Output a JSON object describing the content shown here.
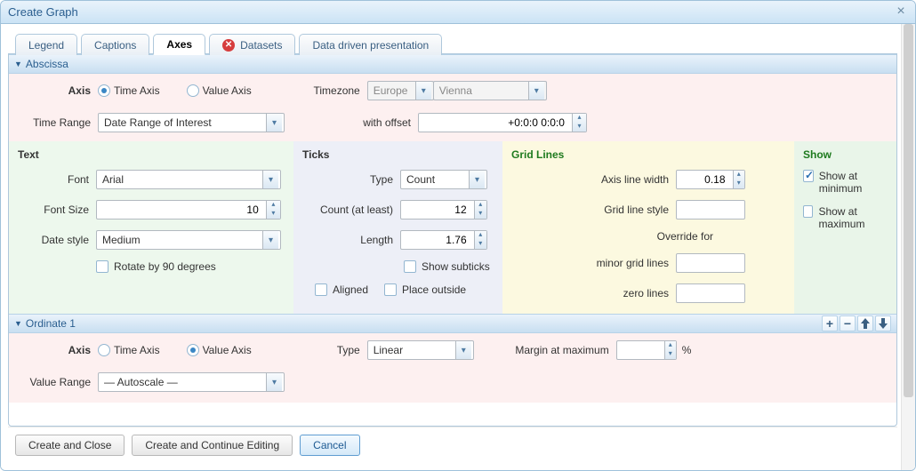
{
  "window": {
    "title": "Create Graph"
  },
  "tabs": {
    "legend": "Legend",
    "captions": "Captions",
    "axes": "Axes",
    "datasets": "Datasets",
    "ddp": "Data driven presentation"
  },
  "abscissa": {
    "header": "Abscissa",
    "axis_label": "Axis",
    "time_axis": "Time Axis",
    "value_axis": "Value Axis",
    "timezone_label": "Timezone",
    "timezone_region": "Europe",
    "timezone_city": "Vienna",
    "time_range_label": "Time Range",
    "time_range_value": "Date Range of Interest",
    "with_offset_label": "with offset",
    "with_offset_value": "+0:0:0 0:0:0"
  },
  "text_panel": {
    "heading": "Text",
    "font_label": "Font",
    "font_value": "Arial",
    "font_size_label": "Font Size",
    "font_size_value": "10",
    "date_style_label": "Date style",
    "date_style_value": "Medium",
    "rotate_label": "Rotate by 90 degrees"
  },
  "ticks_panel": {
    "heading": "Ticks",
    "type_label": "Type",
    "type_value": "Count",
    "count_label": "Count (at least)",
    "count_value": "12",
    "length_label": "Length",
    "length_value": "1.76",
    "show_subticks_label": "Show subticks",
    "aligned_label": "Aligned",
    "place_outside_label": "Place outside"
  },
  "grid_panel": {
    "heading": "Grid Lines",
    "axis_line_width_label": "Axis line width",
    "axis_line_width_value": "0.18",
    "grid_line_style_label": "Grid line style",
    "override_label": "Override for",
    "minor_label": "minor grid lines",
    "zero_label": "zero lines"
  },
  "show_panel": {
    "heading": "Show",
    "show_min": "Show at minimum",
    "show_max": "Show at maximum"
  },
  "ordinate": {
    "header": "Ordinate 1",
    "axis_label": "Axis",
    "time_axis": "Time Axis",
    "value_axis": "Value Axis",
    "type_label": "Type",
    "type_value": "Linear",
    "margin_label": "Margin at maximum",
    "margin_unit": "%",
    "value_range_label": "Value Range",
    "value_range_value": "— Autoscale —"
  },
  "footer": {
    "create_close": "Create and Close",
    "create_continue": "Create and Continue Editing",
    "cancel": "Cancel"
  }
}
